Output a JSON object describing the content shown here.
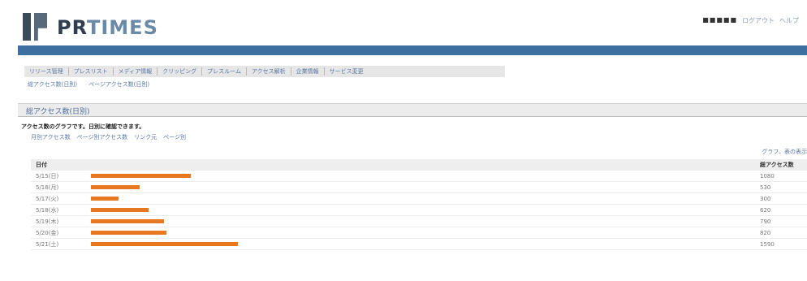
{
  "header": {
    "logo_text_pr": "PR",
    "logo_text_times": "TIMES",
    "user": "■■■■■",
    "links": [
      "ログアウト",
      "ヘルプ"
    ]
  },
  "colors": {
    "brand_bar": "#3d6fa0",
    "bar_fill": "#e8781f",
    "link": "#5a78a6"
  },
  "nav": {
    "tabs": [
      "リリース管理",
      "プレスリスト",
      "メディア情報",
      "クリッピング",
      "プレスルーム",
      "アクセス解析",
      "企業情報",
      "サービス変更"
    ],
    "subnav": [
      "総アクセス数(日別)",
      "ページアクセス数(日別)"
    ]
  },
  "section": {
    "title": "総アクセス数(日別)",
    "note": "アクセス数のグラフです。日別に確認できます。",
    "links": [
      "月別アクセス数",
      "ページ別アクセス数",
      "リンク元",
      "ページ別"
    ],
    "tools": "グラフ、表の表示"
  },
  "table": {
    "header_date": "日付",
    "header_count": "総アクセス数"
  },
  "chart_data": {
    "type": "bar",
    "orientation": "horizontal",
    "categories": [
      "5/15(日)",
      "5/16(月)",
      "5/17(火)",
      "5/18(水)",
      "5/19(木)",
      "5/20(金)",
      "5/21(土)"
    ],
    "values": [
      1080,
      530,
      300,
      620,
      790,
      820,
      1590
    ],
    "xlim": [
      0,
      1600
    ]
  }
}
